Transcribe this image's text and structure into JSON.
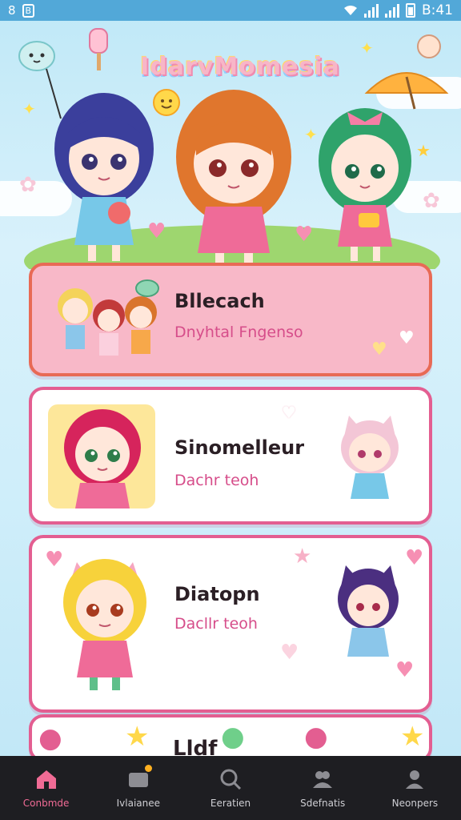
{
  "status_bar": {
    "left_icons": [
      "8",
      "B"
    ],
    "time": "B:41",
    "icons": [
      "wifi-icon",
      "signal-icon",
      "signal-icon",
      "battery-icon"
    ]
  },
  "app": {
    "title": "IdarvMomesia"
  },
  "colors": {
    "accent": "#f06b95",
    "card_border": "#e35e91",
    "card1_bg": "#f8b8c8",
    "nav_bg": "#1e1e22"
  },
  "cards": [
    {
      "title": "Bllecach",
      "subtitle": "Dnyhtal Fngenso"
    },
    {
      "title": "Sinomelleur",
      "subtitle": "Dachr teoh"
    },
    {
      "title": "Diatopn",
      "subtitle": "Dacllr teoh"
    },
    {
      "title": "Lldf"
    }
  ],
  "bottom_nav": {
    "items": [
      {
        "label": "Conbmde",
        "icon": "home-icon",
        "active": true
      },
      {
        "label": "Ivlaianee",
        "icon": "message-icon",
        "active": false
      },
      {
        "label": "Eeratien",
        "icon": "search-icon",
        "active": false
      },
      {
        "label": "Sdefnatis",
        "icon": "people-icon",
        "active": false
      },
      {
        "label": "Neonpers",
        "icon": "profile-icon",
        "active": false
      }
    ]
  }
}
